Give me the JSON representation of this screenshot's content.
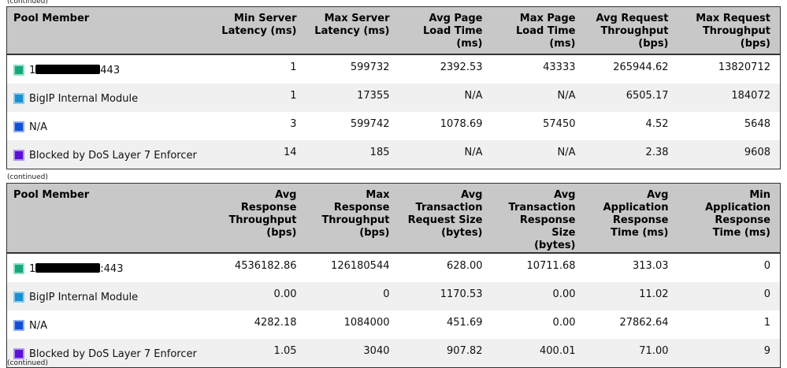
{
  "continued_label": "(continued)",
  "tables": [
    {
      "headers": [
        "Pool Member",
        "Min Server\nLatency (ms)",
        "Max Server\nLatency (ms)",
        "Avg Page\nLoad Time\n(ms)",
        "Max Page\nLoad Time\n(ms)",
        "Avg Request\nThroughput\n(bps)",
        "Max Request\nThroughput\n(bps)"
      ],
      "rows": [
        {
          "prefix": "1",
          "suffix": "443",
          "values": [
            "1",
            "599732",
            "2392.53",
            "43333",
            "265944.62",
            "13820712"
          ]
        },
        {
          "name": "BigIP Internal Module",
          "values": [
            "1",
            "17355",
            "N/A",
            "N/A",
            "6505.17",
            "184072"
          ]
        },
        {
          "name": "N/A",
          "values": [
            "3",
            "599742",
            "1078.69",
            "57450",
            "4.52",
            "5648"
          ]
        },
        {
          "name": "Blocked by DoS Layer 7 Enforcer",
          "values": [
            "14",
            "185",
            "N/A",
            "N/A",
            "2.38",
            "9608"
          ]
        }
      ]
    },
    {
      "headers": [
        "Pool Member",
        "Avg Response\nThroughput\n(bps)",
        "Max Response\nThroughput\n(bps)",
        "Avg\nTransaction\nRequest Size\n(bytes)",
        "Avg\nTransaction\nResponse Size\n(bytes)",
        "Avg\nApplication\nResponse\nTime (ms)",
        "Min\nApplication\nResponse\nTime (ms)"
      ],
      "rows": [
        {
          "prefix": "1",
          "suffix": ":443",
          "values": [
            "4536182.86",
            "126180544",
            "628.00",
            "10711.68",
            "313.03",
            "0"
          ]
        },
        {
          "name": "BigIP Internal Module",
          "values": [
            "0.00",
            "0",
            "1170.53",
            "0.00",
            "11.02",
            "0"
          ]
        },
        {
          "name": "N/A",
          "values": [
            "4282.18",
            "1084000",
            "451.69",
            "0.00",
            "27862.64",
            "1"
          ]
        },
        {
          "name": "Blocked by DoS Layer 7 Enforcer",
          "values": [
            "1.05",
            "3040",
            "907.82",
            "400.01",
            "71.00",
            "9"
          ]
        }
      ]
    }
  ],
  "swatch_colors": [
    {
      "fill": "#17a67e",
      "border": "#8fe0c6"
    },
    {
      "fill": "#1a90d2",
      "border": "#8cc8ec"
    },
    {
      "fill": "#1150d4",
      "border": "#90aef0"
    },
    {
      "fill": "#5a12d6",
      "border": "#b090f0"
    }
  ]
}
